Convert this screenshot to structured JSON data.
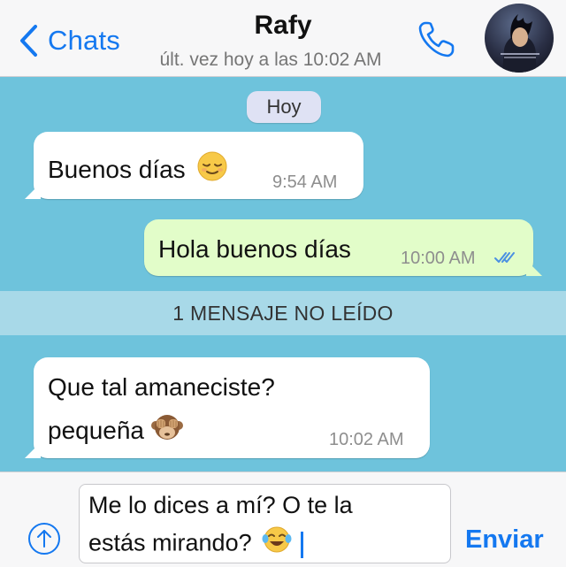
{
  "header": {
    "back_label": "Chats",
    "contact_name": "Rafy",
    "last_seen": "últ. vez hoy a las 10:02 AM"
  },
  "chat": {
    "date_label": "Hoy",
    "unread_banner": "1 MENSAJE NO LEÍDO",
    "messages": [
      {
        "direction": "incoming",
        "text": "Buenos días",
        "emoji": "relieved-face",
        "time": "9:54 AM"
      },
      {
        "direction": "outgoing",
        "text": "Hola buenos días",
        "time": "10:00 AM",
        "status": "read"
      },
      {
        "direction": "incoming",
        "line1": "Que tal amaneciste?",
        "line2": "pequeña",
        "emoji": "see-no-evil-monkey",
        "time": "10:02 AM"
      }
    ]
  },
  "composer": {
    "line1": "Me lo dices a mí? O te la",
    "line2": "estás mirando?",
    "emoji": "face-with-tears-of-joy",
    "send_label": "Enviar"
  },
  "colors": {
    "accent": "#1478f0",
    "chat_background": "#6ec3dc",
    "outgoing_bubble": "#e2fdc9",
    "incoming_bubble": "#ffffff",
    "read_ticks": "#4a90e2"
  }
}
